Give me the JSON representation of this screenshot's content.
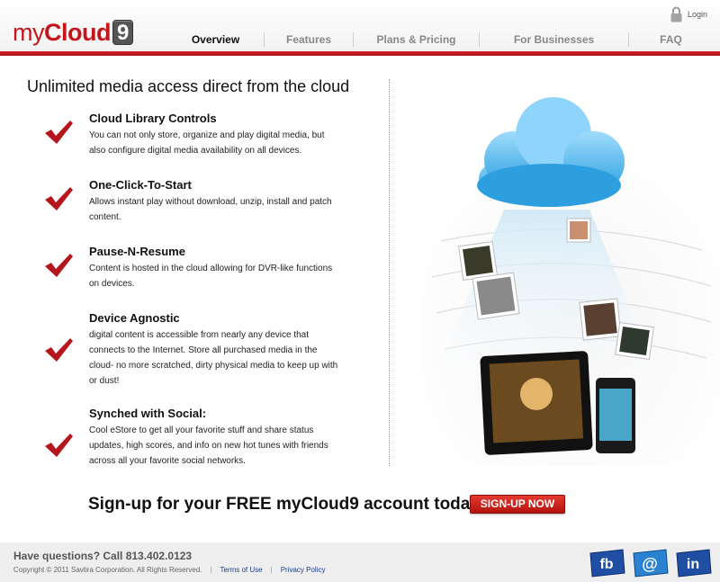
{
  "logo": {
    "prefix": "my",
    "brand": "Cloud",
    "number": "9"
  },
  "header": {
    "login_label": "Login"
  },
  "nav": [
    {
      "label": "Overview",
      "active": true
    },
    {
      "label": "Features",
      "active": false
    },
    {
      "label": "Plans & Pricing",
      "active": false
    },
    {
      "label": "For Businesses",
      "active": false
    },
    {
      "label": "FAQ",
      "active": false
    }
  ],
  "main": {
    "headline": "Unlimited media access direct from the cloud",
    "features": [
      {
        "title": "Cloud Library Controls",
        "description": "You can not only store, organize and play digital media, but also configure digital media availability on all devices."
      },
      {
        "title": "One-Click-To-Start",
        "description": "Allows instant play without download, unzip, install and patch content."
      },
      {
        "title": "Pause-N-Resume",
        "description": "Content is hosted in the cloud allowing for DVR-like functions on devices."
      },
      {
        "title": "Device Agnostic",
        "description": "digital content is accessible from nearly any device that connects to the Internet. Store all purchased media in the cloud- no more scratched, dirty physical media to keep up with or dust!"
      },
      {
        "title": "Synched with Social:",
        "description": "Cool eStore to get all your favorite stuff and share status updates, high scores, and info on new hot tunes with friends across all your favorite social networks."
      }
    ]
  },
  "signup": {
    "text": "Sign-up for your FREE myCloud9 account today!",
    "button_label": "SIGN-UP NOW"
  },
  "footer": {
    "question": "Have questions? Call 813.402.0123",
    "copyright": "Copyright © 2011 Savtira Corporation. All Rights Reserved.",
    "separator": "|",
    "terms_label": "Terms of Use",
    "privacy_label": "Privacy Policy",
    "social": [
      {
        "icon": "facebook-icon",
        "label": "fb"
      },
      {
        "icon": "email-icon",
        "label": "@"
      },
      {
        "icon": "linkedin-icon",
        "label": "in"
      }
    ]
  },
  "colors": {
    "brand_red": "#c4161c",
    "link_blue": "#1a3f8c",
    "cloud_blue": "#46b4ec"
  }
}
